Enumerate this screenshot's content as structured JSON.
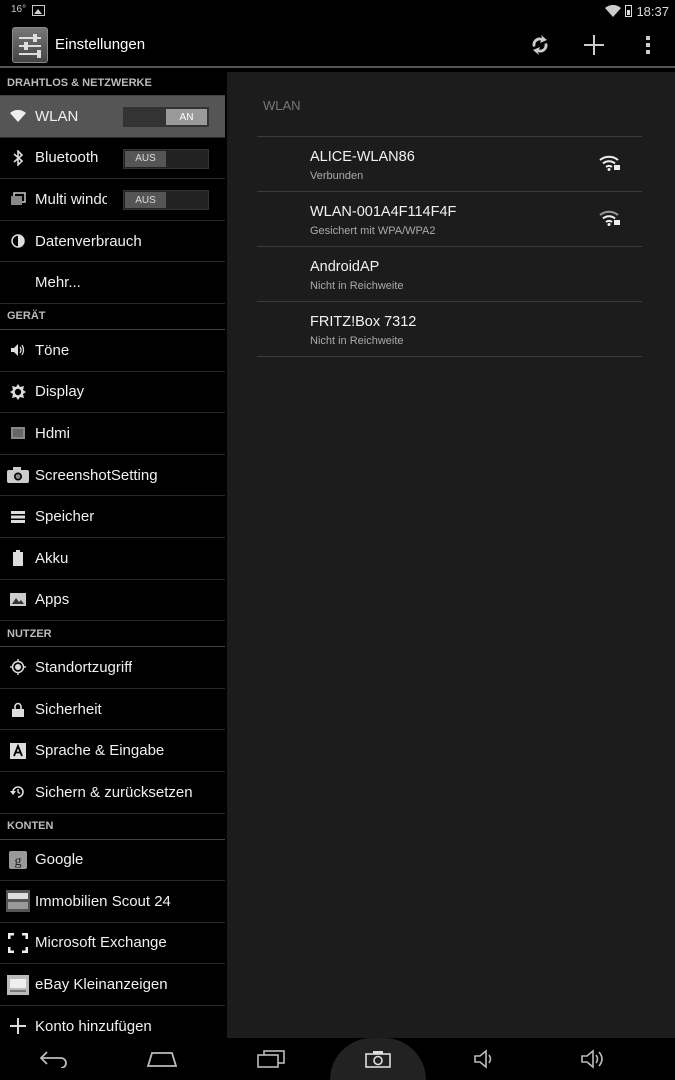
{
  "status_bar": {
    "temperature": "16°",
    "time": "18:37"
  },
  "action_bar": {
    "title": "Einstellungen"
  },
  "sidebar": {
    "sections": [
      {
        "label": "DRAHTLOS & NETZWERKE"
      },
      {
        "label": "GERÄT"
      },
      {
        "label": "NUTZER"
      },
      {
        "label": "KONTEN"
      }
    ],
    "wireless": [
      {
        "label": "WLAN",
        "toggle": "AN",
        "state": "on",
        "icon": "wifi-icon"
      },
      {
        "label": "Bluetooth",
        "toggle": "AUS",
        "state": "off",
        "icon": "bluetooth-icon"
      },
      {
        "label": "Multi window",
        "toggle": "AUS",
        "state": "off",
        "icon": "multi-window-icon"
      },
      {
        "label": "Datenverbrauch",
        "icon": "data-usage-icon"
      },
      {
        "label": "Mehr..."
      }
    ],
    "device": [
      {
        "label": "Töne",
        "icon": "speaker-icon"
      },
      {
        "label": "Display",
        "icon": "brightness-icon"
      },
      {
        "label": "Hdmi",
        "icon": "hdmi-icon"
      },
      {
        "label": "ScreenshotSetting",
        "icon": "camera-icon"
      },
      {
        "label": "Speicher",
        "icon": "storage-icon"
      },
      {
        "label": "Akku",
        "icon": "battery-icon"
      },
      {
        "label": "Apps",
        "icon": "apps-icon"
      }
    ],
    "personal": [
      {
        "label": "Standortzugriff",
        "icon": "location-icon"
      },
      {
        "label": "Sicherheit",
        "icon": "lock-icon"
      },
      {
        "label": "Sprache & Eingabe",
        "icon": "language-icon"
      },
      {
        "label": "Sichern & zurücksetzen",
        "icon": "backup-icon"
      }
    ],
    "accounts": [
      {
        "label": "Google",
        "icon": "google-icon"
      },
      {
        "label": "Immobilien Scout 24",
        "icon": "immoscout-icon"
      },
      {
        "label": "Microsoft Exchange",
        "icon": "exchange-icon"
      },
      {
        "label": "eBay Kleinanzeigen",
        "icon": "ebay-icon"
      },
      {
        "label": "Konto hinzufügen",
        "icon": "add-icon"
      }
    ]
  },
  "wlan_panel": {
    "title": "WLAN",
    "networks": [
      {
        "name": "ALICE-WLAN86",
        "status": "Verbunden",
        "signal": true
      },
      {
        "name": "WLAN-001A4F114F4F",
        "status": "Gesichert mit WPA/WPA2",
        "signal": true
      },
      {
        "name": "AndroidAP",
        "status": "Nicht in Reichweite",
        "signal": false
      },
      {
        "name": "FRITZ!Box 7312",
        "status": "Nicht in Reichweite",
        "signal": false
      }
    ]
  }
}
